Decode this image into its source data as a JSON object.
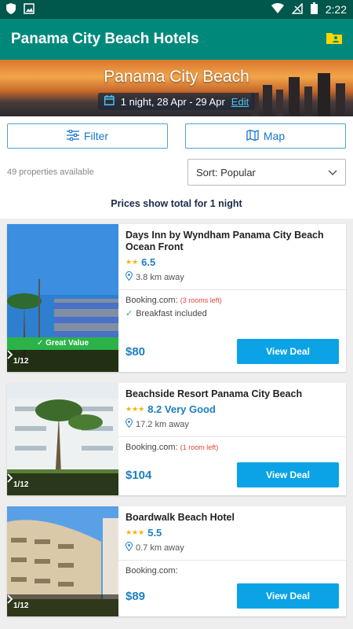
{
  "status_bar": {
    "time": "2:22"
  },
  "app_bar": {
    "title": "Panama City Beach Hotels"
  },
  "hero": {
    "city": "Panama City Beach",
    "dates": "1 night, 28 Apr - 29 Apr",
    "edit_label": "Edit"
  },
  "controls": {
    "filter_label": "Filter",
    "map_label": "Map"
  },
  "results": {
    "count_text": "49 properties available",
    "sort_label": "Sort: Popular",
    "price_note": "Prices show total for 1 night"
  },
  "hotels": [
    {
      "name": "Days Inn by Wyndham Panama City Beach Ocean Front",
      "stars": "★★",
      "rating": "6.5",
      "distance": "3.8 km away",
      "provider": "Booking.com:",
      "rooms_left": "(3 rooms left)",
      "perk": "Breakfast included",
      "badge": "✓ Great Value",
      "pager": "1/12",
      "price": "$80",
      "deal_label": "View Deal"
    },
    {
      "name": "Beachside Resort Panama City Beach",
      "stars": "★★★",
      "rating": "8.2 Very Good",
      "distance": "17.2 km away",
      "provider": "Booking.com:",
      "rooms_left": "(1 room left)",
      "pager": "1/12",
      "price": "$104",
      "deal_label": "View Deal"
    },
    {
      "name": "Boardwalk Beach Hotel",
      "stars": "★★★",
      "rating": "5.5",
      "distance": "0.7 km away",
      "provider": "Booking.com:",
      "pager": "1/12",
      "price": "$89",
      "deal_label": "View Deal"
    }
  ],
  "colors": {
    "app_bar": "#00897b",
    "status_bar": "#00574b",
    "accent": "#0ba3e6",
    "great_value": "#2bb34a"
  },
  "icons": [
    "shield-icon",
    "image-icon",
    "wifi-icon",
    "signal-icon",
    "battery-icon",
    "contact-folder-icon",
    "calendar-icon",
    "filter-sliders-icon",
    "map-icon",
    "chevron-down-icon",
    "location-pin-icon",
    "checkmark-icon",
    "chevron-right-icon"
  ]
}
